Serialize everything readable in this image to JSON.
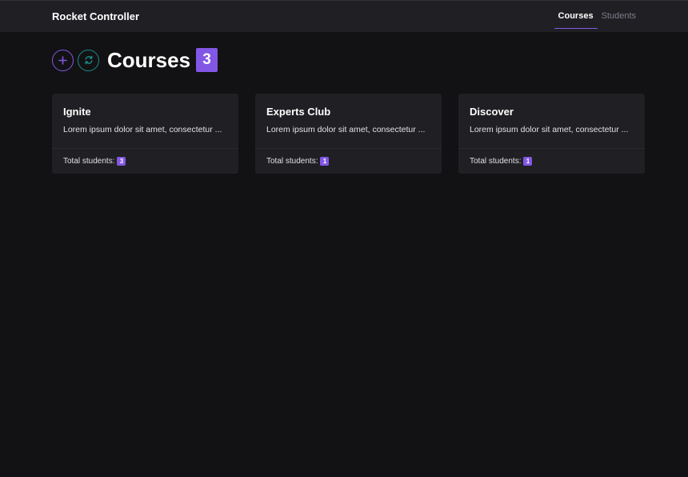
{
  "navbar": {
    "brand": "Rocket Controller",
    "links": [
      {
        "label": "Courses",
        "active": true
      },
      {
        "label": "Students",
        "active": false
      }
    ]
  },
  "header": {
    "add_icon": "plus-icon",
    "refresh_icon": "refresh-icon",
    "title": "Courses",
    "count": "3"
  },
  "courses": [
    {
      "name": "Ignite",
      "description": "Lorem ipsum dolor sit amet, consectetur ...",
      "students_label": "Total students:",
      "students_count": "3"
    },
    {
      "name": "Experts Club",
      "description": "Lorem ipsum dolor sit amet, consectetur ...",
      "students_label": "Total students:",
      "students_count": "1"
    },
    {
      "name": "Discover",
      "description": "Lorem ipsum dolor sit amet, consectetur ...",
      "students_label": "Total students:",
      "students_count": "1"
    }
  ],
  "colors": {
    "accent": "#8257e5",
    "secondary": "#1e8a8a",
    "background": "#121214",
    "surface": "#202024"
  }
}
